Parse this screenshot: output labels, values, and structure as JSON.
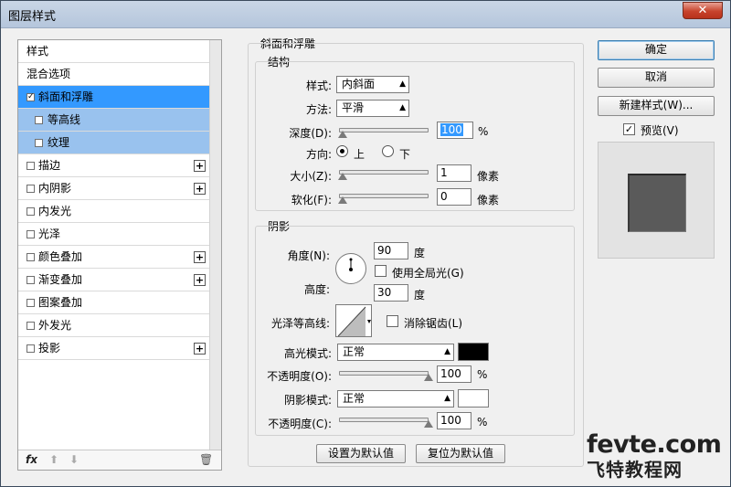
{
  "window": {
    "title": "图层样式",
    "close_glyph": "✕"
  },
  "sidebar": {
    "items": [
      {
        "label": "样式"
      },
      {
        "label": "混合选项"
      },
      {
        "label": "斜面和浮雕",
        "checked": true,
        "selected": true
      },
      {
        "label": "等高线",
        "checked": false
      },
      {
        "label": "纹理",
        "checked": false
      },
      {
        "label": "描边",
        "checked": false,
        "has_add": true
      },
      {
        "label": "内阴影",
        "checked": false,
        "has_add": true
      },
      {
        "label": "内发光",
        "checked": false
      },
      {
        "label": "光泽",
        "checked": false
      },
      {
        "label": "颜色叠加",
        "checked": false,
        "has_add": true
      },
      {
        "label": "渐变叠加",
        "checked": false,
        "has_add": true
      },
      {
        "label": "图案叠加",
        "checked": false
      },
      {
        "label": "外发光",
        "checked": false
      },
      {
        "label": "投影",
        "checked": false,
        "has_add": true
      }
    ],
    "check_glyph": "✓",
    "add_glyph": "+",
    "toolbar": {
      "fx": "fx",
      "up": "⬆",
      "down": "⬇",
      "trash": "🗑"
    }
  },
  "bevel": {
    "section_title": "斜面和浮雕",
    "structure": {
      "title": "结构",
      "style_label": "样式:",
      "style_value": "内斜面",
      "technique_label": "方法:",
      "technique_value": "平滑",
      "depth_label": "深度(D):",
      "depth_value": "100",
      "depth_unit": "%",
      "depth_level": 0.0,
      "direction_label": "方向:",
      "direction_up": "上",
      "direction_down": "下",
      "direction_selected": "上",
      "size_label": "大小(Z):",
      "size_value": "1",
      "size_unit": "像素",
      "soften_label": "软化(F):",
      "soften_value": "0",
      "soften_unit": "像素"
    },
    "shading": {
      "title": "阴影",
      "angle_label": "角度(N):",
      "angle_value": "90",
      "angle_unit": "度",
      "global_light_label": "使用全局光(G)",
      "global_light_checked": false,
      "altitude_label": "高度:",
      "altitude_value": "30",
      "altitude_unit": "度",
      "gloss_contour_label": "光泽等高线:",
      "anti_alias_label": "消除锯齿(L)",
      "anti_alias_checked": false,
      "highlight_mode_label": "高光模式:",
      "highlight_mode_value": "正常",
      "highlight_color": "#000000",
      "highlight_opacity_label": "不透明度(O):",
      "highlight_opacity_value": "100",
      "highlight_opacity_unit": "%",
      "shadow_mode_label": "阴影模式:",
      "shadow_mode_value": "正常",
      "shadow_color": "#ffffff",
      "shadow_opacity_label": "不透明度(C):",
      "shadow_opacity_value": "100",
      "shadow_opacity_unit": "%"
    },
    "make_default_label": "设置为默认值",
    "reset_default_label": "复位为默认值"
  },
  "actions": {
    "ok_label": "确定",
    "cancel_label": "取消",
    "new_style_label": "新建样式(W)...",
    "preview_label": "预览(V)",
    "preview_checked": true
  },
  "watermark": {
    "line1": "fevte.com",
    "line2": "飞特教程网"
  }
}
